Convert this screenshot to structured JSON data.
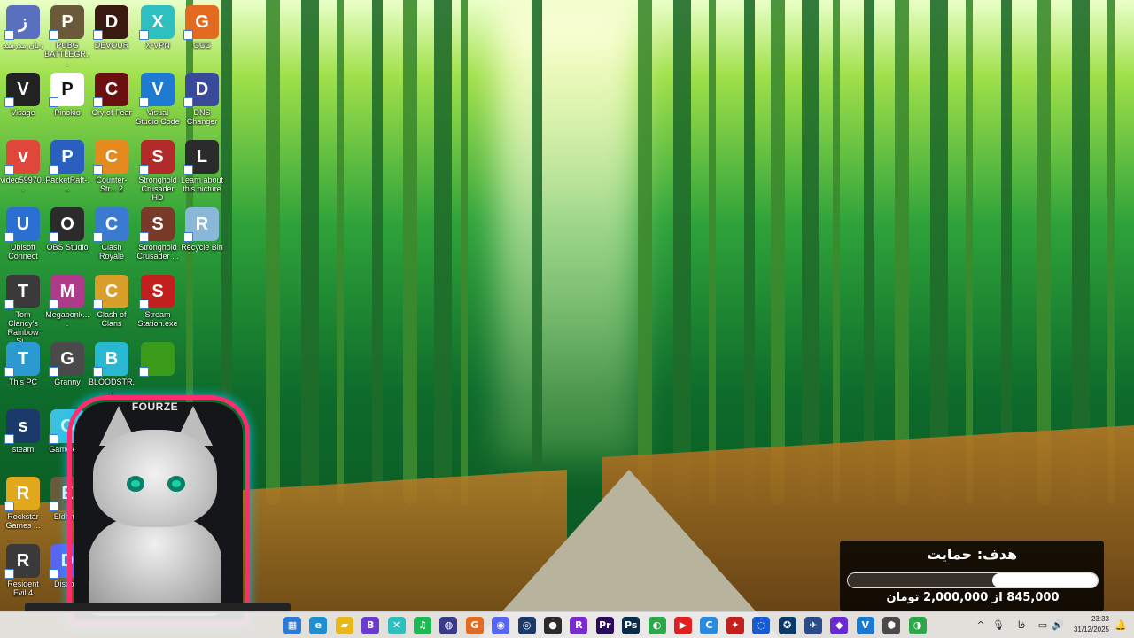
{
  "desktop": {
    "icons": [
      {
        "label": "زبان مدرسه",
        "icon": "star-icon",
        "color": "#5b6fbf"
      },
      {
        "label": "PUBG BATTLEGR...",
        "icon": "pubg-icon",
        "color": "#6b5a3a"
      },
      {
        "label": "DEVOUR",
        "icon": "devour-icon",
        "color": "#3a1a10"
      },
      {
        "label": "X-VPN",
        "icon": "xvpn-icon",
        "color": "#2fbfbf"
      },
      {
        "label": "GCC",
        "icon": "gcc-icon",
        "color": "#e36b1f"
      },
      {
        "label": "Visage",
        "icon": "visage-icon",
        "color": "#222222"
      },
      {
        "label": "Pinokio",
        "icon": "pinokio-icon",
        "color": "#ffffff"
      },
      {
        "label": "Cry of Fear",
        "icon": "cryoffear-icon",
        "color": "#6a1010"
      },
      {
        "label": "Visual Studio Code",
        "icon": "vscode-icon",
        "color": "#1f7ad1"
      },
      {
        "label": "DNS Changer",
        "icon": "dns-icon",
        "color": "#3a4a9a"
      },
      {
        "label": "video59970...",
        "icon": "video-icon",
        "color": "#e0463a"
      },
      {
        "label": "PacketRaft-...",
        "icon": "packetraft-icon",
        "color": "#2a5fbf"
      },
      {
        "label": "Counter-Str... 2",
        "icon": "counterstrike-icon",
        "color": "#e58a1f"
      },
      {
        "label": "Stronghold Crusader HD",
        "icon": "stronghold-icon",
        "color": "#b22a2a"
      },
      {
        "label": "Learn about this picture",
        "icon": "learn-icon",
        "color": "#2b2b2b"
      },
      {
        "label": "Ubisoft Connect",
        "icon": "ubisoft-icon",
        "color": "#2a6fd1"
      },
      {
        "label": "OBS Studio",
        "icon": "obs-icon",
        "color": "#2b2b2b"
      },
      {
        "label": "Clash Royale",
        "icon": "clashroyale-icon",
        "color": "#3a7ad1"
      },
      {
        "label": "Stronghold Crusader ...",
        "icon": "stronghold2-icon",
        "color": "#7a3a2a"
      },
      {
        "label": "Recycle Bin",
        "icon": "recycle-bin-icon",
        "color": "#8ab8d8"
      },
      {
        "label": "Tom Clancy's Rainbow Si...",
        "icon": "rainbow6-icon",
        "color": "#3a3a3a"
      },
      {
        "label": "Megabonk....",
        "icon": "megabonk-icon",
        "color": "#b03a8a"
      },
      {
        "label": "Clash of Clans",
        "icon": "clashofclans-icon",
        "color": "#d8a02a"
      },
      {
        "label": "Stream Station.exe",
        "icon": "streamstation-icon",
        "color": "#c21f1f"
      },
      {
        "label": "This PC",
        "icon": "this-pc-icon",
        "color": "#2a9ad1"
      },
      {
        "label": "Granny",
        "icon": "granny-icon",
        "color": "#4a4a4a"
      },
      {
        "label": "BLOODSTR...",
        "icon": "bloodstrike-icon",
        "color": "#2ab8d1"
      },
      {
        "label": "",
        "icon": "nvidia-icon",
        "color": "#3a9a1a"
      },
      {
        "label": "steam",
        "icon": "steam-icon",
        "color": "#1b3a6a"
      },
      {
        "label": "Gameloop",
        "icon": "gameloop-icon",
        "color": "#3ac1e0"
      },
      {
        "label": "Rockstar Games ...",
        "icon": "rockstar-icon",
        "color": "#e0a81a"
      },
      {
        "label": "Elden...",
        "icon": "eldenring-icon",
        "color": "#6a5a3a"
      },
      {
        "label": "Resident Evil 4",
        "icon": "residentevil-icon",
        "color": "#3a3a3a"
      },
      {
        "label": "Disco...",
        "icon": "discord-icon",
        "color": "#5865f2"
      }
    ]
  },
  "overlay": {
    "brand": "FOURZE",
    "goal": {
      "title": "هدف: حمایت",
      "amount_text": "845,000 از 2,000,000 تومان",
      "raised": 845000,
      "target": 2000000
    }
  },
  "taskbar": {
    "apps": [
      {
        "icon": "explorer-icon",
        "color": "#2a7ad8",
        "glyph": "▦"
      },
      {
        "icon": "edge-icon",
        "color": "#1f8fd1",
        "glyph": "e"
      },
      {
        "icon": "folder-icon",
        "color": "#e8b81a",
        "glyph": "▰"
      },
      {
        "icon": "bypass-icon",
        "color": "#6a3ad1",
        "glyph": "B"
      },
      {
        "icon": "xvpn-taskbar-icon",
        "color": "#2fbfbf",
        "glyph": "✕"
      },
      {
        "icon": "spotify-icon",
        "color": "#1db954",
        "glyph": "♫"
      },
      {
        "icon": "app-globe-icon",
        "color": "#3a3a8a",
        "glyph": "◍"
      },
      {
        "icon": "gcc-taskbar-icon",
        "color": "#e36b1f",
        "glyph": "G"
      },
      {
        "icon": "discord-taskbar-icon",
        "color": "#5865f2",
        "glyph": "◉"
      },
      {
        "icon": "steam-taskbar-icon",
        "color": "#1b3a6a",
        "glyph": "◎"
      },
      {
        "icon": "obs-taskbar-icon",
        "color": "#2b2b2b",
        "glyph": "●"
      },
      {
        "icon": "r-app-icon",
        "color": "#7a2ad1",
        "glyph": "R"
      },
      {
        "icon": "premiere-icon",
        "color": "#2a0a5a",
        "glyph": "Pr"
      },
      {
        "icon": "photoshop-icon",
        "color": "#0a2a4a",
        "glyph": "Ps"
      },
      {
        "icon": "chrome-icon",
        "color": "#2aa84a",
        "glyph": "◐"
      },
      {
        "icon": "youtube-icon",
        "color": "#e01f1f",
        "glyph": "▶"
      },
      {
        "icon": "app-c-icon",
        "color": "#2a8ae0",
        "glyph": "C"
      },
      {
        "icon": "devour-taskbar-icon",
        "color": "#c21f1f",
        "glyph": "✦"
      },
      {
        "icon": "app-swirl-icon",
        "color": "#1a5ad1",
        "glyph": "◌"
      },
      {
        "icon": "app-world-icon",
        "color": "#0a3a6a",
        "glyph": "✪"
      },
      {
        "icon": "app-bird-icon",
        "color": "#2a4a8a",
        "glyph": "✈"
      },
      {
        "icon": "visual-studio-icon",
        "color": "#6a2ad1",
        "glyph": "◆"
      },
      {
        "icon": "app-v-icon",
        "color": "#1a7ad1",
        "glyph": "V"
      },
      {
        "icon": "app-box-icon",
        "color": "#4a4a4a",
        "glyph": "⬢"
      },
      {
        "icon": "chrome2-icon",
        "color": "#2aa84a",
        "glyph": "◑"
      }
    ],
    "tray": {
      "chevron": "^",
      "mic": "🎙",
      "lang": "فا",
      "network": "▭",
      "volume": "🔊",
      "time": "23:33",
      "date": "31/12/2025",
      "notification": "🔔"
    }
  }
}
